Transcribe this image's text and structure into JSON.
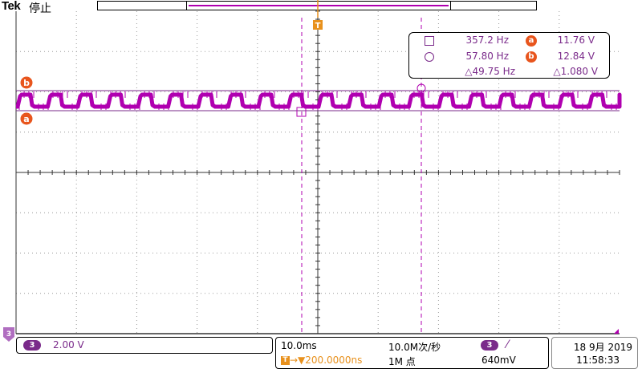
{
  "header": {
    "brand": "Tek",
    "run_state": "停止"
  },
  "markers": {
    "cursor_a_label": "a",
    "cursor_b_label": "b",
    "trigger_point_label": "T",
    "channel3_ground_label": "3"
  },
  "cursor_readout": {
    "square_freq": "357.2 Hz",
    "circle_freq": "57.80 Hz",
    "delta_freq": "△49.75 Hz",
    "a_label": "a",
    "a_value": "11.76 V",
    "b_label": "b",
    "b_value": "12.84 V",
    "delta_voltage": "△1.080 V"
  },
  "status": {
    "channel_badge": "3",
    "channel_scale": "2.00 V",
    "timebase": "10.0ms",
    "trigger_icon": "T",
    "trigger_position": "→▼200.0000ns",
    "sample_rate": "10.0M次/秒",
    "record_length": "1M 点",
    "trigger_channel_badge": "3",
    "trigger_slope": "⁄",
    "trigger_level": "640mV",
    "date": "18 9月 2019",
    "time": "11:58:33"
  },
  "colors": {
    "trace": "#b000b0",
    "cursor_line": "#7a2a8a",
    "marker_orange": "#e8551d",
    "trigger_orange": "#e8911d"
  }
}
